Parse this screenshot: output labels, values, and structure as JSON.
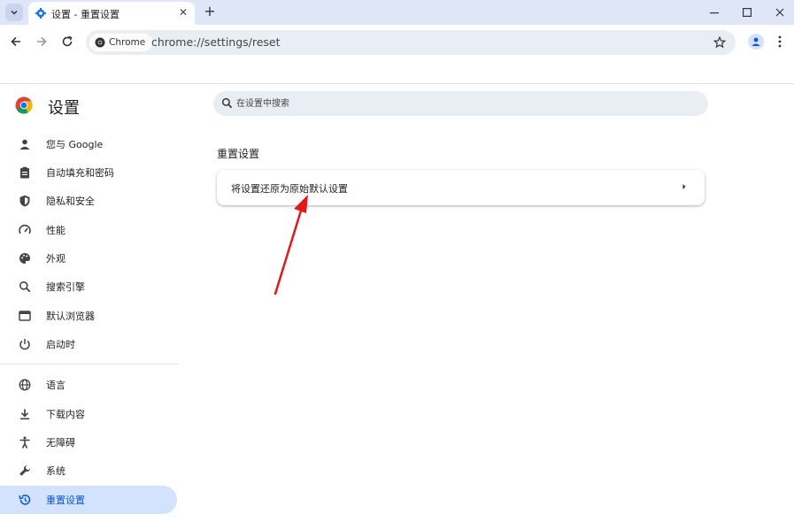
{
  "tab": {
    "title": "设置 - 重置设置",
    "close_icon": "close-icon",
    "new_tab_label": "+"
  },
  "window_controls": [
    "minimize-icon",
    "maximize-icon",
    "close-icon"
  ],
  "toolbar": {
    "chip_label": "Chrome",
    "url": "chrome://settings/reset"
  },
  "sidebar": {
    "title": "设置",
    "items": [
      {
        "label": "您与 Google",
        "icon": "person-icon"
      },
      {
        "label": "自动填充和密码",
        "icon": "clipboard-icon"
      },
      {
        "label": "隐私和安全",
        "icon": "shield-icon"
      },
      {
        "label": "性能",
        "icon": "speedometer-icon"
      },
      {
        "label": "外观",
        "icon": "palette-icon"
      },
      {
        "label": "搜索引擎",
        "icon": "search-icon"
      },
      {
        "label": "默认浏览器",
        "icon": "browser-icon"
      },
      {
        "label": "启动时",
        "icon": "power-icon"
      },
      {
        "label": "语言",
        "icon": "globe-icon"
      },
      {
        "label": "下载内容",
        "icon": "download-icon"
      },
      {
        "label": "无障碍",
        "icon": "accessibility-icon"
      },
      {
        "label": "系统",
        "icon": "wrench-icon"
      },
      {
        "label": "重置设置",
        "icon": "restore-icon",
        "active": true
      }
    ]
  },
  "search": {
    "placeholder": "在设置中搜索"
  },
  "main": {
    "section_title": "重置设置",
    "card_label": "将设置还原为原始默认设置"
  },
  "colors": {
    "accent": "#0b57d0",
    "active_bg": "#d3e3fd",
    "annotation_arrow": "#e0191b"
  }
}
